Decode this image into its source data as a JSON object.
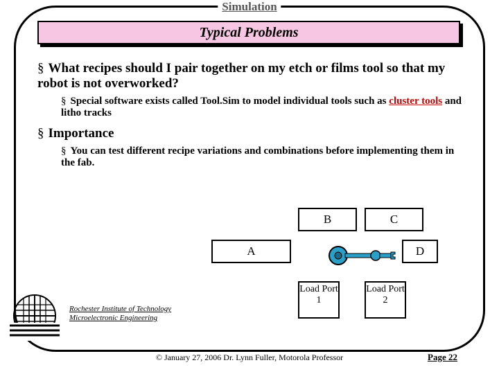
{
  "header": {
    "title": "Simulation"
  },
  "subtitle": "Typical Problems",
  "bullets": {
    "q1": "What recipes should I pair together on my etch or films tool so that my robot is not overworked?",
    "q1_sub_prefix": "Special software exists called Tool.Sim to model individual tools such as ",
    "q1_sub_link": "cluster tools",
    "q1_sub_suffix": " and litho tracks",
    "q2": "Importance",
    "q2_sub": "You can test different recipe variations and combinations before implementing them in the fab."
  },
  "diagram": {
    "A": "A",
    "B": "B",
    "C": "C",
    "D": "D",
    "load1": "Load Port 1",
    "load2": "Load Port 2"
  },
  "footer": {
    "inst1": "Rochester Institute of Technology",
    "inst2": "Microelectronic Engineering",
    "center": "© January 27, 2006  Dr. Lynn Fuller, Motorola Professor",
    "page": "Page 22"
  }
}
